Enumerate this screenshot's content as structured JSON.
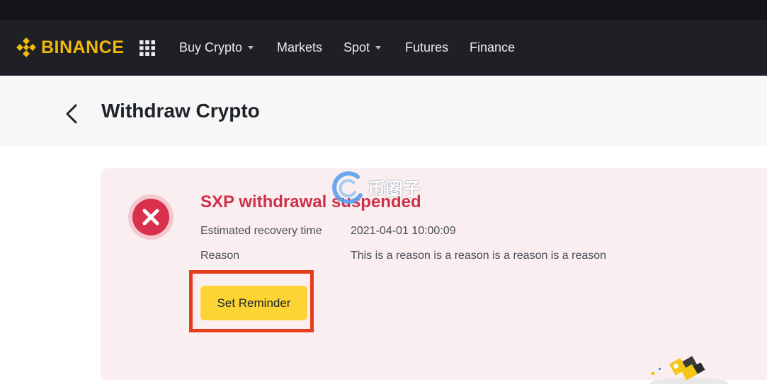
{
  "header": {
    "brand": "BINANCE",
    "nav": [
      {
        "label": "Buy Crypto",
        "dropdown": true
      },
      {
        "label": "Markets",
        "dropdown": false
      },
      {
        "label": "Spot",
        "dropdown": true
      },
      {
        "label": "Futures",
        "dropdown": false
      },
      {
        "label": "Finance",
        "dropdown": false
      }
    ]
  },
  "page": {
    "title": "Withdraw Crypto"
  },
  "alert": {
    "title": "SXP withdrawal suspended",
    "recovery_label": "Estimated recovery time",
    "recovery_value": "2021-04-01 10:00:09",
    "reason_label": "Reason",
    "reason_value": "This is a reason is a reason is a reason is a reason",
    "button_label": "Set Reminder"
  },
  "watermark": {
    "text": "币圈子"
  },
  "colors": {
    "brand": "#f0b90b",
    "nav_bg": "#1e2026",
    "alert_bg": "#fbeef0",
    "alert_title": "#cf304a",
    "button": "#fcd535",
    "highlight": "#e53e1f"
  },
  "icons": [
    "binance-logo-icon",
    "grid-menu-icon",
    "chevron-down-icon",
    "back-arrow-icon",
    "error-x-icon",
    "mascot-icon"
  ]
}
